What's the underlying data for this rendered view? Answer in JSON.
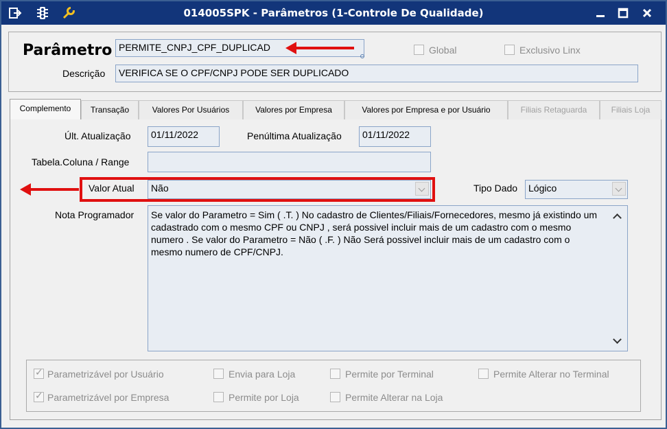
{
  "window": {
    "title": "014005SPK - Parâmetros (1-Controle De Qualidade)",
    "title_icons": [
      "exit-icon",
      "traffic-light-icon",
      "wrench-icon"
    ],
    "buttons": [
      "minimize",
      "maximize",
      "close"
    ]
  },
  "header": {
    "parametro_label": "Parâmetro",
    "parametro_value": "PERMITE_CNPJ_CPF_DUPLICAD",
    "global_label": "Global",
    "global_checked": false,
    "exclusivo_label": "Exclusivo Linx",
    "exclusivo_checked": false,
    "descricao_label": "Descrição",
    "descricao_value": "VERIFICA SE O CPF/CNPJ PODE SER DUPLICADO"
  },
  "tabs": [
    {
      "label": "Complemento",
      "active": true,
      "enabled": true
    },
    {
      "label": "Transação",
      "active": false,
      "enabled": true
    },
    {
      "label": "Valores Por Usuários",
      "active": false,
      "enabled": true
    },
    {
      "label": "Valores por Empresa",
      "active": false,
      "enabled": true
    },
    {
      "label": "Valores por Empresa e por Usuário",
      "active": false,
      "enabled": true
    },
    {
      "label": "Filiais Retaguarda",
      "active": false,
      "enabled": false
    },
    {
      "label": "Filiais Loja",
      "active": false,
      "enabled": false
    }
  ],
  "complemento": {
    "ult_atualizacao_label": "Últ. Atualização",
    "ult_atualizacao_value": "01/11/2022",
    "penultima_label": "Penúltima Atualização",
    "penultima_value": "01/11/2022",
    "tabela_label": "Tabela.Coluna / Range",
    "tabela_value": "",
    "valor_atual_label": "Valor Atual",
    "valor_atual_value": "Não",
    "tipo_dado_label": "Tipo Dado",
    "tipo_dado_value": "Lógico",
    "nota_label": "Nota Programador",
    "nota_value": "Se valor do Parametro = Sim ( .T. )  No cadastro de Clientes/Filiais/Fornecedores, mesmo já existindo um cadastrado com o mesmo CPF ou CNPJ , será possivel incluir mais de um cadastro com o mesmo numero .    Se valor do Parametro = Não ( .F. )  Não Será possivel incluir mais de um cadastro com o mesmo numero de CPF/CNPJ."
  },
  "options": {
    "param_usuario": {
      "label": "Parametrizável por Usuário",
      "checked": true
    },
    "envia_loja": {
      "label": "Envia para Loja",
      "checked": false
    },
    "permite_terminal": {
      "label": "Permite por Terminal",
      "checked": false
    },
    "permite_alterar_terminal": {
      "label": "Permite Alterar no Terminal",
      "checked": false
    },
    "param_empresa": {
      "label": "Parametrizável por Empresa",
      "checked": true
    },
    "permite_loja": {
      "label": "Permite por Loja",
      "checked": false
    },
    "permite_alterar_loja": {
      "label": "Permite Alterar na Loja",
      "checked": false
    }
  },
  "colors": {
    "titlebar": "#12357a",
    "annotation": "#e01010",
    "field_bg": "#e8edf3"
  }
}
